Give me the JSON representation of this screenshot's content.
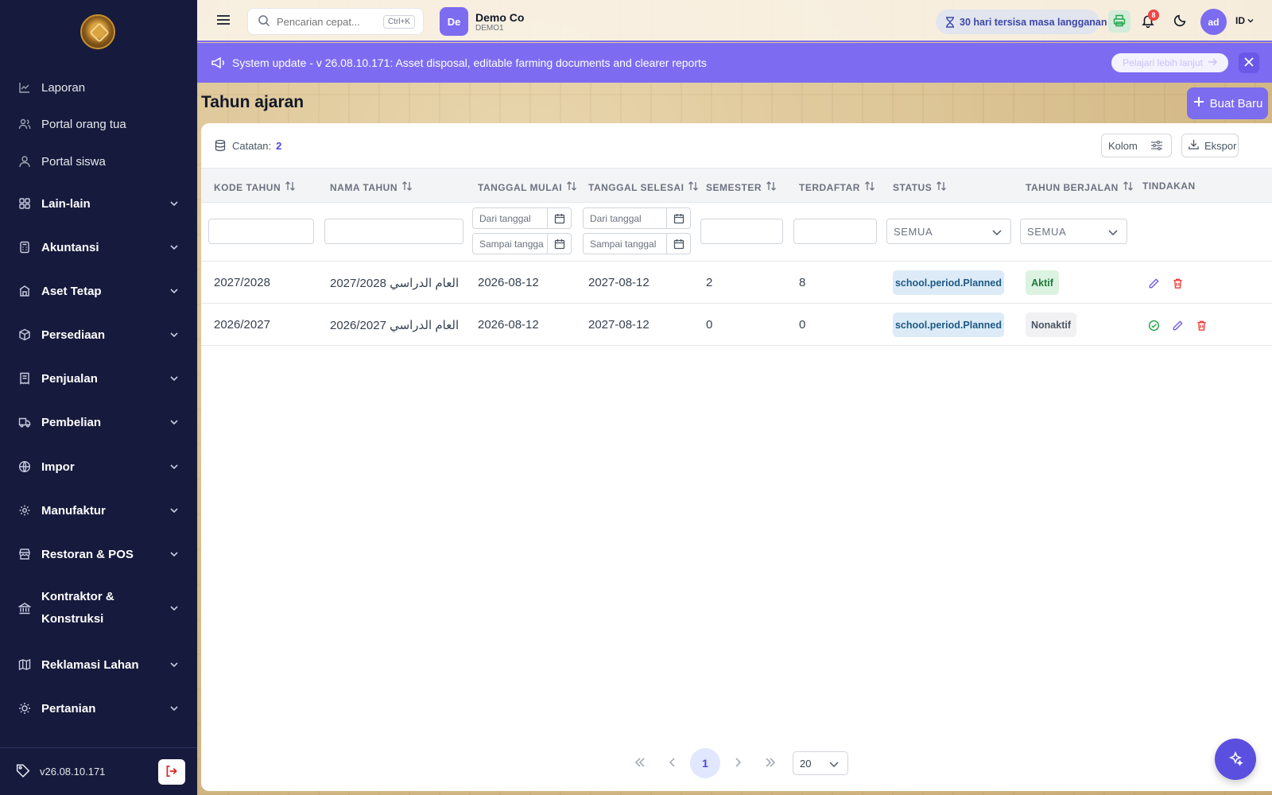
{
  "sidebar": {
    "items": [
      {
        "label": "Laporan",
        "icon": "chart-line-icon"
      },
      {
        "label": "Portal orang tua",
        "icon": "users-icon"
      },
      {
        "label": "Portal siswa",
        "icon": "user-icon"
      },
      {
        "label": "Lain-lain",
        "icon": "grid-icon"
      },
      {
        "label": "Akuntansi",
        "icon": "calculator-icon"
      },
      {
        "label": "Aset Tetap",
        "icon": "building-icon"
      },
      {
        "label": "Persediaan",
        "icon": "box-icon"
      },
      {
        "label": "Penjualan",
        "icon": "receipt-icon"
      },
      {
        "label": "Pembelian",
        "icon": "truck-icon"
      },
      {
        "label": "Impor",
        "icon": "globe-icon"
      },
      {
        "label": "Manufaktur",
        "icon": "gear-icon"
      },
      {
        "label": "Restoran & POS",
        "icon": "store-icon"
      },
      {
        "label": "Kontraktor & Konstruksi",
        "label_line1": "Kontraktor &",
        "label_line2": "Konstruksi",
        "icon": "landmark-icon"
      },
      {
        "label": "Reklamasi Lahan",
        "icon": "map-icon"
      },
      {
        "label": "Pertanian",
        "icon": "sun-icon"
      }
    ],
    "version": "v26.08.10.171"
  },
  "topbar": {
    "search_placeholder": "Pencarian cepat...",
    "shortcut": "Ctrl+K",
    "company_initials": "De",
    "company_name": "Demo Co",
    "company_code": "DEMO1",
    "subscription": "30 hari tersisa masa langganan",
    "notification_count": "8",
    "user_initials": "ad",
    "language": "ID"
  },
  "banner": {
    "text": "System update - v 26.08.10.171: Asset disposal, editable farming documents and clearer reports",
    "learn_more": "Pelajari lebih lanjut"
  },
  "page": {
    "title": "Tahun ajaran",
    "create_button": "Buat Baru"
  },
  "table": {
    "records_label": "Catatan:",
    "records_count": "2",
    "columns_button": "Kolom",
    "export_button": "Ekspor",
    "headers": [
      "KODE TAHUN",
      "NAMA TAHUN",
      "TANGGAL MULAI",
      "TANGGAL SELESAI",
      "SEMESTER",
      "TERDAFTAR",
      "STATUS",
      "TAHUN BERJALAN",
      "TINDAKAN"
    ],
    "filters": {
      "date_from": "Dari tanggal",
      "date_to": "Sampai tanggal",
      "start_to": "Sampai tangga",
      "all": "SEMUA"
    },
    "rows": [
      {
        "code": "2027/2028",
        "name": "العام الدراسي 2027/2028",
        "start": "2026-08-12",
        "end": "2027-08-12",
        "semester": "2",
        "enrolled": "8",
        "status": "school.period.Planned",
        "current": "Aktif"
      },
      {
        "code": "2026/2027",
        "name": "العام الدراسي 2026/2027",
        "start": "2026-08-12",
        "end": "2027-08-12",
        "semester": "0",
        "enrolled": "0",
        "status": "school.period.Planned",
        "current": "Nonaktif"
      }
    ]
  },
  "pagination": {
    "current_page": "1",
    "page_size": "20"
  },
  "colors": {
    "sidebar_bg": "#161b3d",
    "accent": "#7c6cf0",
    "banner_bg": "#7d6cf2",
    "danger": "#ef4444",
    "success": "#22a34a"
  }
}
